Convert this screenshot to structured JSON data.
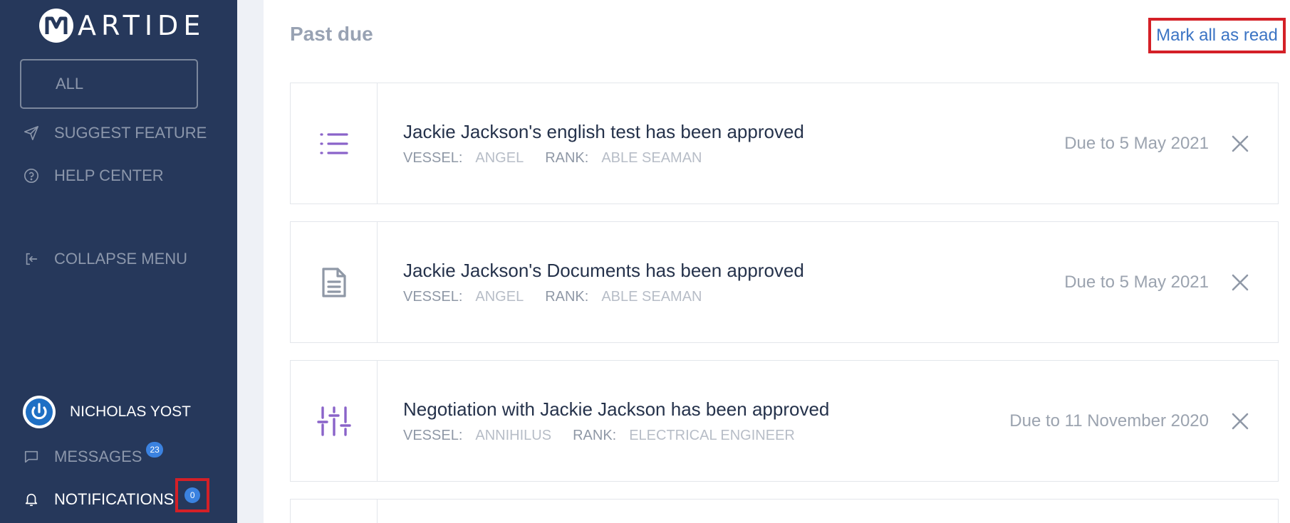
{
  "brand": {
    "name": "ARTIDE",
    "logo_letter": "M"
  },
  "sidebar": {
    "all_label": "ALL",
    "items": [
      {
        "label": "SUGGEST FEATURE",
        "icon": "send-icon"
      },
      {
        "label": "HELP CENTER",
        "icon": "question-circle-icon"
      },
      {
        "label": "COLLAPSE MENU",
        "icon": "collapse-icon"
      }
    ],
    "user": {
      "name": "NICHOLAS YOST"
    },
    "messages": {
      "label": "MESSAGES",
      "count": "23"
    },
    "notifications": {
      "label": "NOTIFICATIONS",
      "count": "0"
    }
  },
  "main": {
    "section_title": "Past due",
    "mark_all_label": "Mark all as read",
    "vessel_key": "VESSEL:",
    "rank_key": "RANK:",
    "notifications": [
      {
        "icon": "list-icon",
        "title": "Jackie Jackson's english test has been approved",
        "vessel": "ANGEL",
        "rank": "ABLE SEAMAN",
        "due": "Due to 5 May 2021"
      },
      {
        "icon": "document-icon",
        "title": "Jackie Jackson's Documents has been approved",
        "vessel": "ANGEL",
        "rank": "ABLE SEAMAN",
        "due": "Due to 5 May 2021"
      },
      {
        "icon": "sliders-icon",
        "title": "Negotiation with Jackie Jackson has been approved",
        "vessel": "ANNIHILUS",
        "rank": "ELECTRICAL ENGINEER",
        "due": "Due to 11 November 2020"
      }
    ]
  },
  "colors": {
    "sidebar_bg": "#26385b",
    "accent_purple": "#8a63c9",
    "link_blue": "#3b74c4",
    "badge_blue": "#3b82e0",
    "highlight_red": "#d42027"
  }
}
